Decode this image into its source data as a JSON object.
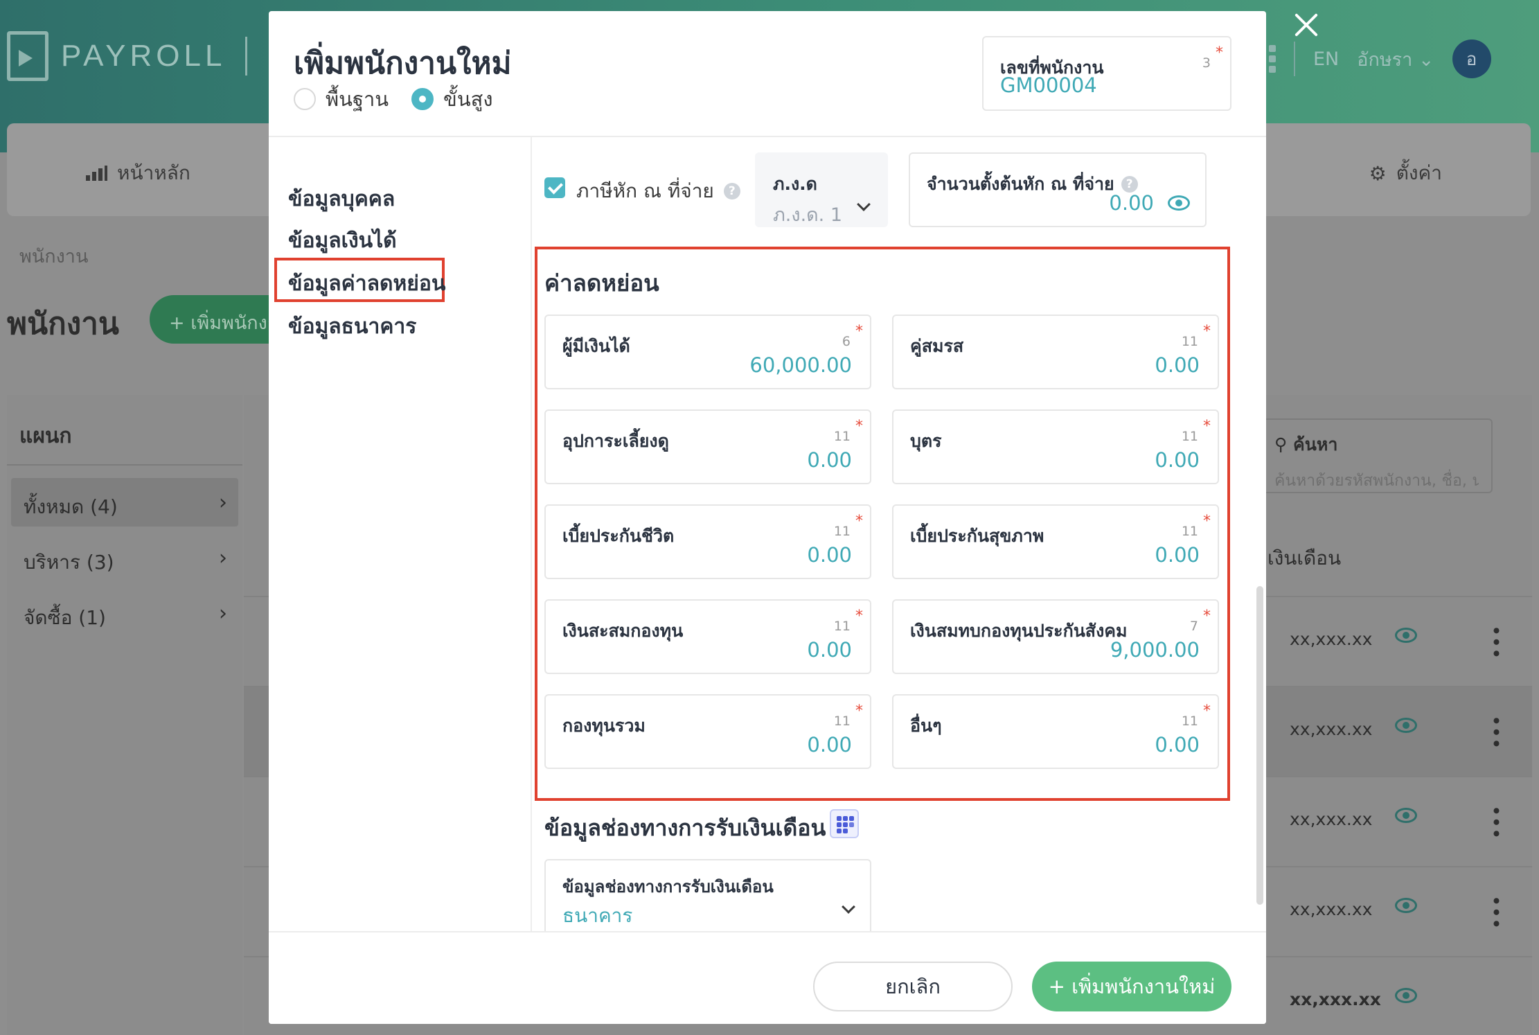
{
  "background": {
    "logo_text": "PAYROLL",
    "lang": "EN",
    "user_name": "อักษรา",
    "avatar_initial": "อ",
    "nav_home": "หน้าหลัก",
    "nav_settings": "ตั้งค่า",
    "breadcrumb": "พนักงาน",
    "page_title": "พนักงาน",
    "add_button": "+ เพิ่มพนักงานใหม่",
    "department_title": "แผนก",
    "departments": [
      {
        "label": "ทั้งหมด (4)"
      },
      {
        "label": "บริหาร (3)"
      },
      {
        "label": "จัดซื้อ (1)"
      }
    ],
    "search_label": "ค้นหา",
    "search_placeholder": "ค้นหาด้วยรหัสพนักงาน, ชื่อ, นามสกุล",
    "salary_column": "เงินเดือน",
    "row_values": [
      "xx,xxx.xx",
      "xx,xxx.xx",
      "xx,xxx.xx",
      "xx,xxx.xx",
      "xx,xxx.xx"
    ]
  },
  "modal": {
    "title": "เพิ่มพนักงานใหม่",
    "modes": {
      "basic": "พื้นฐาน",
      "advanced": "ขั้นสูง"
    },
    "selected_mode": "advanced",
    "employee_id": {
      "label": "เลขที่พนักงาน",
      "count": "3",
      "value": "GM00004"
    },
    "side_nav": [
      {
        "label": "ข้อมูลบุคคล"
      },
      {
        "label": "ข้อมูลเงินได้"
      },
      {
        "label": "ข้อมูลค่าลดหย่อน"
      },
      {
        "label": "ข้อมูลธนาคาร"
      }
    ],
    "withholding": {
      "checkbox_label": "ภาษีหัก ณ ที่จ่าย",
      "checked": true,
      "form_label": "ภ.ง.ด",
      "form_value": "ภ.ง.ด. 1",
      "initial_label": "จำนวนตั้งต้นหัก ณ ที่จ่าย",
      "initial_value": "0.00"
    },
    "deductions": {
      "title": "ค่าลดหย่อน",
      "fields": [
        {
          "label": "ผู้มีเงินได้",
          "count": "6",
          "value": "60,000.00"
        },
        {
          "label": "คู่สมรส",
          "count": "11",
          "value": "0.00"
        },
        {
          "label": "อุปการะเลี้ยงดู",
          "count": "11",
          "value": "0.00"
        },
        {
          "label": "บุตร",
          "count": "11",
          "value": "0.00"
        },
        {
          "label": "เบี้ยประกันชีวิต",
          "count": "11",
          "value": "0.00"
        },
        {
          "label": "เบี้ยประกันสุขภาพ",
          "count": "11",
          "value": "0.00"
        },
        {
          "label": "เงินสะสมกองทุน",
          "count": "11",
          "value": "0.00"
        },
        {
          "label": "เงินสมทบกองทุนประกันสังคม",
          "count": "7",
          "value": "9,000.00"
        },
        {
          "label": "กองทุนรวม",
          "count": "11",
          "value": "0.00"
        },
        {
          "label": "อื่นๆ",
          "count": "11",
          "value": "0.00"
        }
      ]
    },
    "salary_channel": {
      "title": "ข้อมูลช่องทางการรับเงินเดือน",
      "field_label": "ข้อมูลช่องทางการรับเงินเดือน",
      "field_value": "ธนาคาร"
    },
    "footer": {
      "cancel": "ยกเลิก",
      "submit": "+ เพิ่มพนักงานใหม่"
    }
  },
  "colors": {
    "accent": "#4db6c4",
    "value_text": "#3fa9b5",
    "highlight": "#e0412f",
    "primary_button": "#5cbf82"
  }
}
